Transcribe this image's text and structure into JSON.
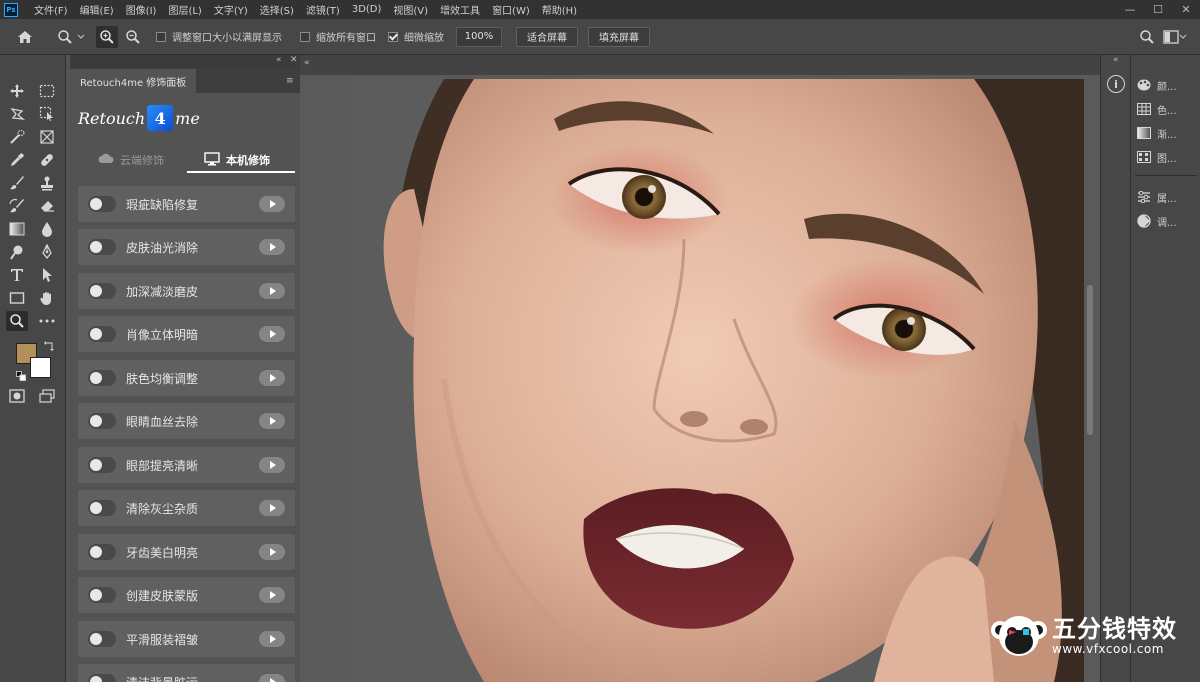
{
  "app": {
    "logo": "Ps"
  },
  "menu": [
    "文件(F)",
    "编辑(E)",
    "图像(I)",
    "图层(L)",
    "文字(Y)",
    "选择(S)",
    "滤镜(T)",
    "3D(D)",
    "视图(V)",
    "增效工具",
    "窗口(W)",
    "帮助(H)"
  ],
  "window_controls": {
    "minimize": "—",
    "restore": "☐",
    "close": "✕"
  },
  "options": {
    "resize_window": "调整窗口大小以满屏显示",
    "zoom_all": "缩放所有窗口",
    "scrubby_zoom": "细微缩放",
    "zoom_value": "100%",
    "fit_screen": "适合屏幕",
    "fill_screen": "填充屏幕"
  },
  "panel": {
    "tab": "Retouch4me 修饰面板",
    "brand_pre": "Retouch",
    "brand_u": "4",
    "brand_post": "me",
    "cloud_tab": "云端修饰",
    "local_tab": "本机修饰",
    "features": [
      "瑕疵缺陷修复",
      "皮肤油光消除",
      "加深减淡磨皮",
      "肖像立体明暗",
      "肤色均衡调整",
      "眼睛血丝去除",
      "眼部提亮清晰",
      "清除灰尘杂质",
      "牙齿美白明亮",
      "创建皮肤蒙版",
      "平滑服装褶皱",
      "清洁背景脏污"
    ]
  },
  "right_panel": {
    "items": [
      {
        "label": "颜...",
        "icon": "palette-icon"
      },
      {
        "label": "色...",
        "icon": "swatches-icon"
      },
      {
        "label": "渐...",
        "icon": "gradient-icon"
      },
      {
        "label": "图...",
        "icon": "patterns-icon"
      },
      {
        "label": "属...",
        "icon": "properties-icon"
      },
      {
        "label": "调...",
        "icon": "adjustments-icon"
      }
    ]
  },
  "colors": {
    "foreground": "#b38f5a",
    "background": "#ffffff"
  },
  "watermark": {
    "title": "五分钱特效",
    "url": "www.vfxcool.com"
  }
}
